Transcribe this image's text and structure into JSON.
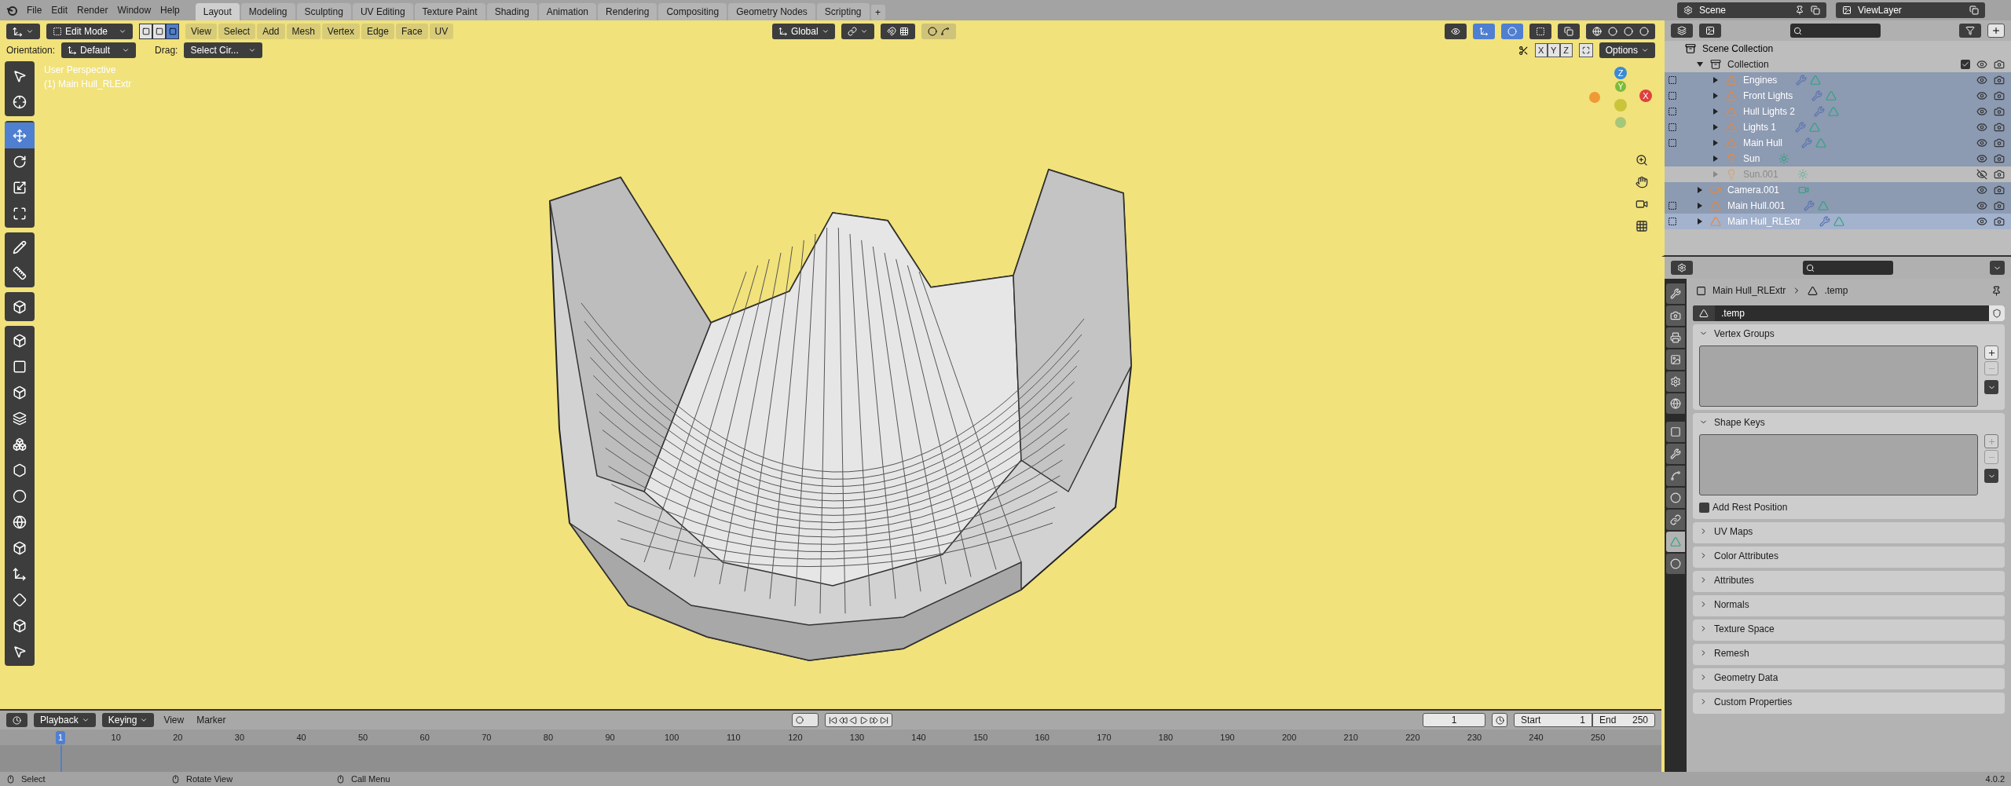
{
  "menus": [
    "File",
    "Edit",
    "Render",
    "Window",
    "Help"
  ],
  "workspaces": [
    {
      "label": "Layout",
      "selected": true
    },
    {
      "label": "Modeling",
      "selected": false
    },
    {
      "label": "Sculpting",
      "selected": false
    },
    {
      "label": "UV Editing",
      "selected": false
    },
    {
      "label": "Texture Paint",
      "selected": false
    },
    {
      "label": "Shading",
      "selected": false
    },
    {
      "label": "Animation",
      "selected": false
    },
    {
      "label": "Rendering",
      "selected": false
    },
    {
      "label": "Compositing",
      "selected": false
    },
    {
      "label": "Geometry Nodes",
      "selected": false
    },
    {
      "label": "Scripting",
      "selected": false
    }
  ],
  "add_workspace": "+",
  "scene": "Scene",
  "view_layer": "ViewLayer",
  "viewport": {
    "mode": "Edit Mode",
    "select_modes": [
      {
        "selected": false
      },
      {
        "selected": false
      },
      {
        "selected": true
      }
    ],
    "menus": [
      "View",
      "Select",
      "Add",
      "Mesh",
      "Vertex",
      "Edge",
      "Face",
      "UV"
    ],
    "transform": "Global",
    "orientation_label": "Orientation:",
    "orientation": "Default",
    "drag_label": "Drag:",
    "drag": "Select Cir...",
    "axes": [
      "X",
      "Y",
      "Z"
    ],
    "options": "Options",
    "info": [
      "User Perspective",
      "(1) Main Hull_RLExtr"
    ],
    "gizmo": {
      "z": "Z",
      "y": "Y",
      "x": "X"
    },
    "tool_groups": [
      {
        "tools": [
          {
            "selected": false
          },
          {
            "selected": false
          }
        ]
      },
      {
        "tools": [
          {
            "selected": true
          },
          {
            "selected": false
          },
          {
            "selected": false
          },
          {
            "selected": false
          }
        ]
      },
      {
        "tools": [
          {
            "selected": false
          },
          {
            "selected": false
          }
        ]
      },
      {
        "tools": [
          {
            "selected": false
          }
        ]
      },
      {
        "tools": [
          {
            "selected": false
          },
          {
            "selected": false
          },
          {
            "selected": false
          },
          {
            "selected": false
          },
          {
            "selected": false
          },
          {
            "selected": false
          },
          {
            "selected": false
          },
          {
            "selected": false
          },
          {
            "selected": false
          },
          {
            "selected": false
          },
          {
            "selected": false
          },
          {
            "selected": false
          },
          {
            "selected": false
          }
        ]
      }
    ]
  },
  "outliner": {
    "root": "Scene Collection",
    "items": [
      {
        "name": "Collection",
        "kind": "collection",
        "expanded": true,
        "checked": true,
        "selected": false,
        "active": false,
        "hidden": false,
        "children": [
          {
            "name": "Engines",
            "kind": "mesh",
            "selected": true,
            "active": false,
            "hidden": false
          },
          {
            "name": "Front Lights",
            "kind": "mesh",
            "selected": true,
            "active": false,
            "hidden": false
          },
          {
            "name": "Hull Lights 2",
            "kind": "mesh",
            "selected": true,
            "active": false,
            "hidden": false
          },
          {
            "name": "Lights 1",
            "kind": "mesh",
            "selected": true,
            "active": false,
            "hidden": false
          },
          {
            "name": "Main Hull",
            "kind": "mesh",
            "selected": true,
            "active": false,
            "hidden": false
          },
          {
            "name": "Sun",
            "kind": "light",
            "selected": true,
            "active": false,
            "hidden": false
          },
          {
            "name": "Sun.001",
            "kind": "light",
            "selected": false,
            "active": false,
            "hidden": true
          }
        ]
      },
      {
        "name": "Camera.001",
        "kind": "camera",
        "selected": true,
        "active": false,
        "hidden": false
      },
      {
        "name": "Main Hull.001",
        "kind": "mesh",
        "selected": true,
        "active": false,
        "hidden": false
      },
      {
        "name": "Main Hull_RLExtr",
        "kind": "mesh",
        "selected": true,
        "active": true,
        "hidden": false
      }
    ]
  },
  "properties": {
    "tabs": [
      {
        "selected": false
      },
      {
        "selected": false
      },
      {
        "selected": false
      },
      {
        "selected": false
      },
      {
        "selected": false
      },
      {
        "selected": false
      },
      {
        "selected": false
      },
      {
        "selected": false
      },
      {
        "selected": false
      },
      {
        "selected": false
      },
      {
        "selected": false
      },
      {
        "selected": true
      },
      {
        "selected": false
      }
    ],
    "breadcrumb": [
      "Main Hull_RLExtr",
      ".temp"
    ],
    "datablock": ".temp",
    "panels": [
      {
        "title": "Vertex Groups",
        "expanded": true
      },
      {
        "title": "Shape Keys",
        "expanded": true,
        "checkbox": {
          "label": "Add Rest Position",
          "checked": false
        }
      },
      {
        "title": "UV Maps",
        "expanded": false
      },
      {
        "title": "Color Attributes",
        "expanded": false
      },
      {
        "title": "Attributes",
        "expanded": false
      },
      {
        "title": "Normals",
        "expanded": false
      },
      {
        "title": "Texture Space",
        "expanded": false
      },
      {
        "title": "Remesh",
        "expanded": false
      },
      {
        "title": "Geometry Data",
        "expanded": false
      },
      {
        "title": "Custom Properties",
        "expanded": false
      }
    ]
  },
  "timeline": {
    "menus": [
      "Playback",
      "Keying",
      "View",
      "Marker"
    ],
    "current_frame": "1",
    "start_label": "Start",
    "start": "1",
    "end_label": "End",
    "end": "250",
    "ruler": [
      "1",
      "10",
      "20",
      "30",
      "40",
      "50",
      "60",
      "70",
      "80",
      "90",
      "100",
      "110",
      "120",
      "130",
      "140",
      "150",
      "160",
      "170",
      "180",
      "190",
      "200",
      "210",
      "220",
      "230",
      "240",
      "250"
    ]
  },
  "status_bar": {
    "hints": [
      "Select",
      "Rotate View",
      "Call Menu"
    ],
    "version": "4.0.2"
  }
}
